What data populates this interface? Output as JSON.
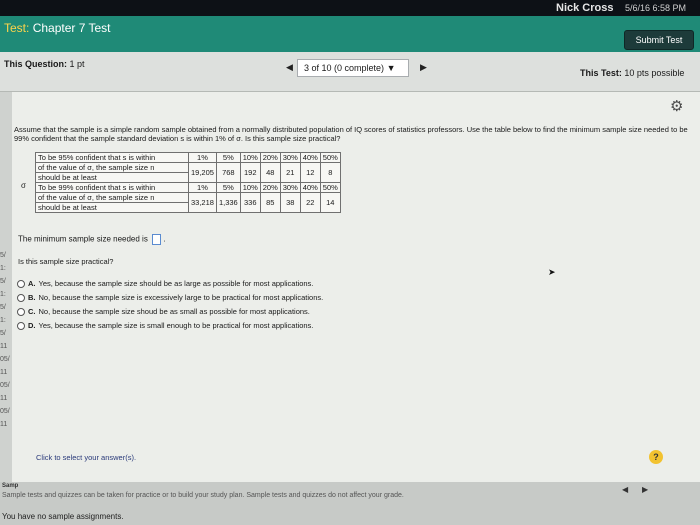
{
  "topbar": {
    "user": "Nick Cross",
    "datetime": "5/6/16 6:58 PM"
  },
  "header": {
    "title_prefix": "Test:",
    "title": "Chapter 7 Test",
    "submit_label": "Submit Test"
  },
  "qbar": {
    "question_label": "This Question:",
    "question_points": "1 pt",
    "progress": "3 of 10 (0 complete)",
    "test_label": "This Test:",
    "test_points": "10 pts possible"
  },
  "gutter": [
    "5/",
    "1:",
    "5/",
    "1:",
    "5/",
    "1:",
    "5/",
    "11",
    "05/",
    "11",
    "05/",
    "11",
    "05/",
    "11"
  ],
  "question": {
    "text": "Assume that the sample is a simple random sample obtained from a normally distributed population of IQ scores of statistics professors. Use the table below to find the minimum sample size needed to be 99% confident that the sample standard deviation s is within 1% of σ. Is this sample size practical?",
    "sigma": "σ",
    "table": {
      "rows": [
        [
          "To be 95% confident that s is within",
          "1%",
          "5%",
          "10%",
          "20%",
          "30%",
          "40%",
          "50%"
        ],
        [
          "of the value of σ, the sample size n",
          "19,205",
          "768",
          "192",
          "48",
          "21",
          "12",
          "8"
        ],
        [
          "should be at least"
        ],
        [
          "To be 99% confident that s is within",
          "1%",
          "5%",
          "10%",
          "20%",
          "30%",
          "40%",
          "50%"
        ],
        [
          "of the value of σ, the sample size n",
          "33,218",
          "1,336",
          "336",
          "85",
          "38",
          "22",
          "14"
        ],
        [
          "should be at least"
        ]
      ]
    },
    "min_size_prompt": "The minimum sample size needed is",
    "min_size_suffix": ".",
    "practical_prompt": "Is this sample size practical?",
    "options": [
      {
        "letter": "A.",
        "text": "Yes, because the sample size should be as large as possible for most applications."
      },
      {
        "letter": "B.",
        "text": "No, because the sample size is excessively large to be practical for most applications."
      },
      {
        "letter": "C.",
        "text": "No, because the sample size shoud be as small as possible for most applications."
      },
      {
        "letter": "D.",
        "text": "Yes, because the sample size is small enough to be practical for most applications."
      }
    ],
    "click_select": "Click to select your answer(s)."
  },
  "icons": {
    "gear": "gear-icon",
    "help": "?",
    "prev": "◀",
    "next": "▶",
    "dropdown": "▼"
  },
  "footer": {
    "header": "Samp",
    "info": "Sample tests and quizzes can be taken for practice or to build your study plan. Sample tests and quizzes do not affect your grade.",
    "no_assign": "You have no sample assignments."
  }
}
